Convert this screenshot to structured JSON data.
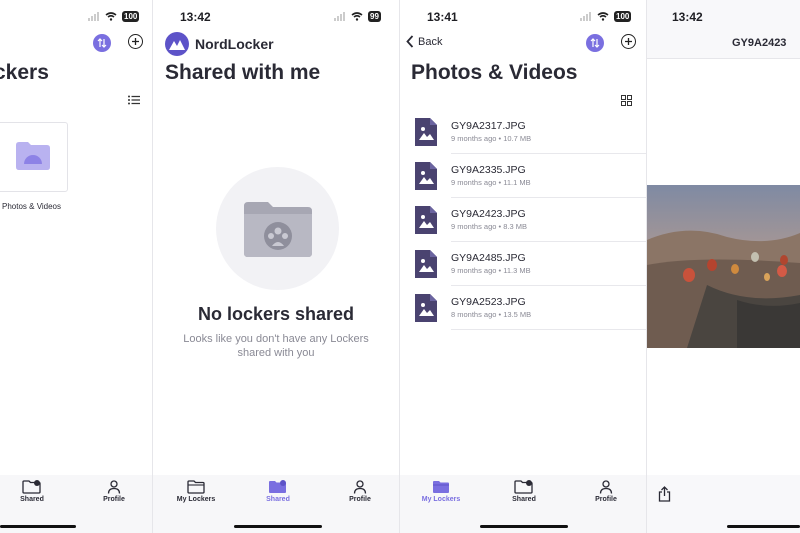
{
  "panel1": {
    "title": "ckers",
    "battery": "100",
    "folder_label": "Photos & Videos",
    "tabs": [
      {
        "label": "Shared",
        "icon": "shared-folder-icon"
      },
      {
        "label": "Profile",
        "icon": "profile-icon"
      }
    ]
  },
  "panel2": {
    "time": "13:42",
    "battery": "99",
    "brand": "NordLocker",
    "title": "Shared with me",
    "empty_title": "No lockers shared",
    "empty_desc_1": "Looks like you don't have any Lockers",
    "empty_desc_2": "shared with you",
    "tabs": [
      {
        "label": "My Lockers",
        "icon": "folder-icon"
      },
      {
        "label": "Shared",
        "icon": "shared-folder-icon"
      },
      {
        "label": "Profile",
        "icon": "profile-icon"
      }
    ],
    "active_tab": "Shared"
  },
  "panel3": {
    "time": "13:41",
    "battery": "100",
    "back_label": "Back",
    "title": "Photos & Videos",
    "files": [
      {
        "name": "GY9A2317.JPG",
        "meta": "9 months ago • 10.7 MB"
      },
      {
        "name": "GY9A2335.JPG",
        "meta": "9 months ago • 11.1 MB"
      },
      {
        "name": "GY9A2423.JPG",
        "meta": "9 months ago • 8.3 MB"
      },
      {
        "name": "GY9A2485.JPG",
        "meta": "9 months ago • 11.3 MB"
      },
      {
        "name": "GY9A2523.JPG",
        "meta": "8 months ago • 13.5 MB"
      }
    ],
    "tabs": [
      {
        "label": "My Lockers",
        "icon": "folder-icon"
      },
      {
        "label": "Shared",
        "icon": "shared-folder-icon"
      },
      {
        "label": "Profile",
        "icon": "profile-icon"
      }
    ],
    "active_tab": "My Lockers"
  },
  "panel4": {
    "time": "13:42",
    "title": "GY9A2423"
  },
  "colors": {
    "accent": "#7a6fe0",
    "file_icon": "#4a4370",
    "folder": "#b9b2f0"
  }
}
